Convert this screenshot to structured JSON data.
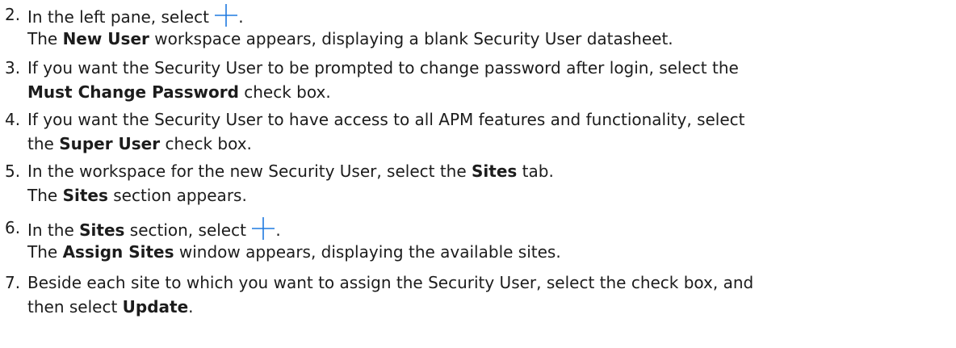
{
  "steps": [
    {
      "number": "2.",
      "line1_before": "In the left pane, select",
      "line1_after": ".",
      "line2_bold": "New User",
      "line2_rest": " workspace appears, displaying a blank Security User datasheet.",
      "line2_the": "The "
    },
    {
      "number": "3.",
      "line1": "If you want the Security User to be prompted to change password after login, select the",
      "line2_bold": "Must Change Password",
      "line2_rest": " check box."
    },
    {
      "number": "4.",
      "line1": "If you want the Security User to have access to all APM features and functionality, select",
      "line2_the": "the ",
      "line2_bold": "Super User",
      "line2_rest": " check box."
    },
    {
      "number": "5.",
      "line1_before": "In the workspace for the new Security User, select the ",
      "line1_bold": "Sites",
      "line1_after": " tab.",
      "line2_the": "The ",
      "line2_bold": "Sites",
      "line2_rest": " section appears."
    },
    {
      "number": "6.",
      "line1_before": "In the ",
      "line1_bold": "Sites",
      "line1_mid": " section, select",
      "line1_after": ".",
      "line2_the": "The ",
      "line2_bold": "Assign Sites",
      "line2_rest": " window appears, displaying the available sites."
    },
    {
      "number": "7.",
      "line1": "Beside each site to which you want to assign the Security User, select the check box, and",
      "line2_the": "then select ",
      "line2_bold": "Update",
      "line2_rest": "."
    }
  ],
  "icons": {
    "plus": "plus-icon",
    "plus_color": "#1f7ae0"
  }
}
